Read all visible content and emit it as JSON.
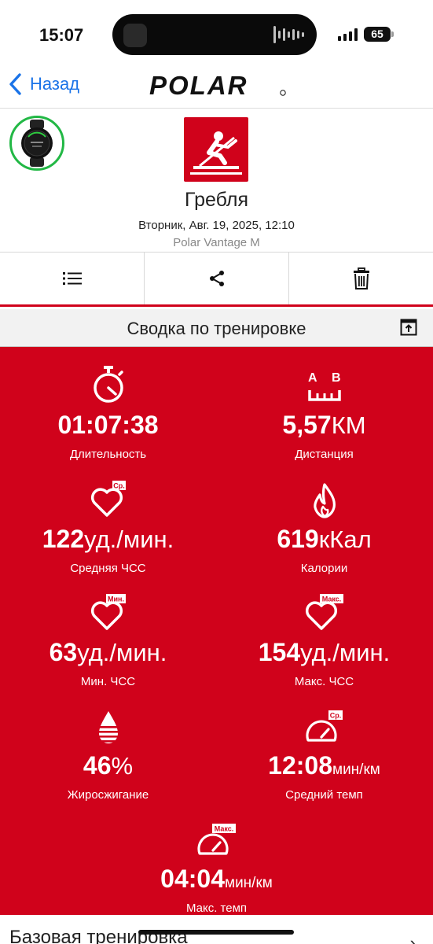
{
  "status_bar": {
    "time": "15:07",
    "battery": "65"
  },
  "nav": {
    "back_label": "Назад",
    "logo_text": "POLAR"
  },
  "workout": {
    "sport": "Гребля",
    "date": "Вторник, Авг. 19, 2025, 12:10",
    "device": "Polar Vantage M"
  },
  "actions": [
    {
      "icon": "list-icon"
    },
    {
      "icon": "share-icon"
    },
    {
      "icon": "trash-icon"
    }
  ],
  "summary": {
    "title": "Сводка по тренировке",
    "stats": {
      "duration": {
        "value": "01:07:38",
        "unit": "",
        "label": "Длительность"
      },
      "distance": {
        "value": "5,57",
        "unit": "КМ",
        "label": "Дистанция",
        "icon_text_a": "A",
        "icon_text_b": "B"
      },
      "avg_hr": {
        "value": "122",
        "unit": "уд./мин.",
        "label": "Средняя ЧСС",
        "badge": "Ср."
      },
      "calories": {
        "value": "619",
        "unit": "кКал",
        "label": "Калории"
      },
      "min_hr": {
        "value": "63",
        "unit": "уд./мин.",
        "label": "Мин. ЧСС",
        "badge": "Мин."
      },
      "max_hr": {
        "value": "154",
        "unit": "уд./мин.",
        "label": "Макс. ЧСС",
        "badge": "Макс."
      },
      "fat_burn": {
        "value": "46",
        "unit": "%",
        "label": "Жиросжигание"
      },
      "avg_pace": {
        "value": "12:08",
        "unit": "мин/км",
        "label": "Средний темп",
        "badge": "Ср."
      },
      "max_pace": {
        "value": "04:04",
        "unit": "мин/км",
        "label": "Макс. темп",
        "badge": "Макс."
      }
    }
  },
  "bottom": {
    "section_title": "Базовая тренировка",
    "arrow": "›"
  },
  "colors": {
    "brand_red": "#d0021b",
    "link_blue": "#1a73e8",
    "watch_ring": "#22b845"
  }
}
